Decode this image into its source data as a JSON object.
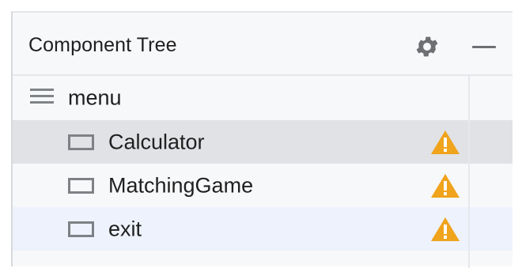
{
  "panel": {
    "title": "Component Tree",
    "actions": {
      "settings_icon": "gear-icon",
      "minimize_icon": "minimize-icon"
    }
  },
  "tree": {
    "root": {
      "label": "menu",
      "icon": "menu-lines-icon"
    },
    "items": [
      {
        "label": "Calculator",
        "icon": "menu-item-icon",
        "warning": true,
        "state": "selected"
      },
      {
        "label": "MatchingGame",
        "icon": "menu-item-icon",
        "warning": true,
        "state": "normal"
      },
      {
        "label": "exit",
        "icon": "menu-item-icon",
        "warning": true,
        "state": "hover"
      }
    ]
  },
  "colors": {
    "panel_bg": "#f7f8fa",
    "selected_row": "#e1e2e5",
    "hover_row": "#edf2fc",
    "warning": "#f0a31c",
    "icon_gray": "#7e8185"
  }
}
